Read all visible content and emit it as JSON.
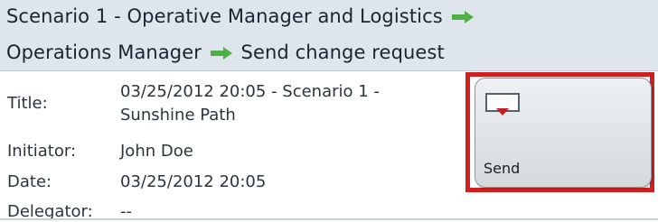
{
  "header": {
    "line1": "Scenario 1 - Operative Manager and Logistics",
    "line2_step1": "Operations Manager",
    "line2_step2": "Send change request",
    "arrow_color": "#4fb048"
  },
  "details": {
    "title_label": "Title:",
    "title_value": "03/25/2012 20:05 - Scenario 1 - Sunshine Path",
    "initiator_label": "Initiator:",
    "initiator_value": "John Doe",
    "date_label": "Date:",
    "date_value": "03/25/2012 20:05",
    "delegator_label": "Delegator:",
    "delegator_value": "--"
  },
  "send_button": {
    "label": "Send",
    "icon": "inbox-send-icon",
    "highlight_color": "#d11f1f"
  }
}
